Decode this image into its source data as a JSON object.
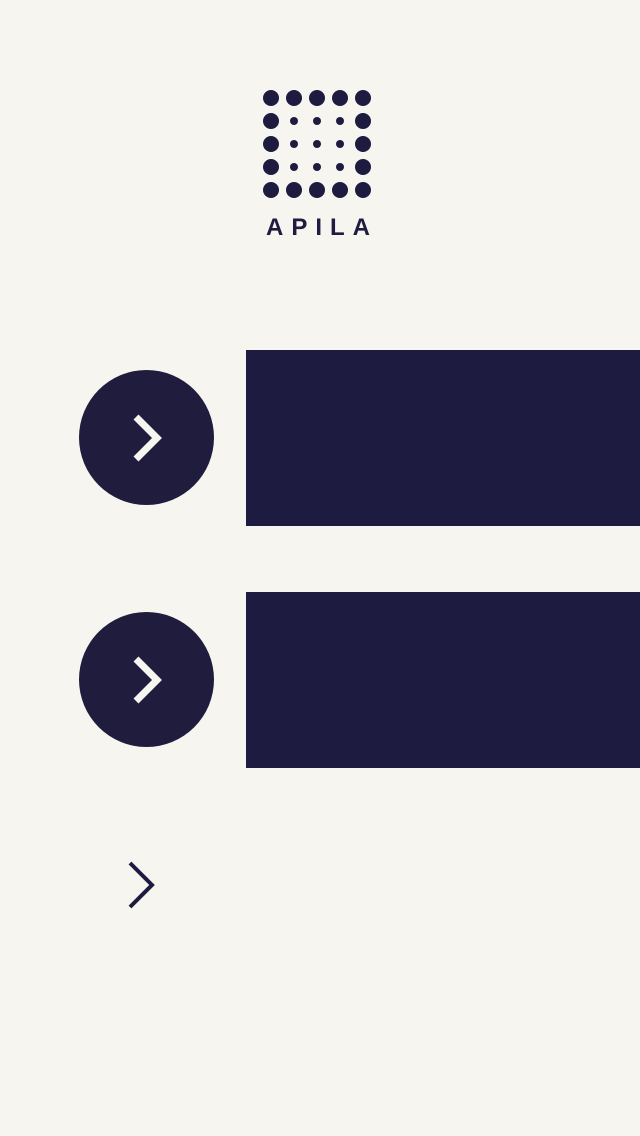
{
  "brand": {
    "name": "APILA",
    "logo_icon": "dot-grid-logo-icon",
    "primary_color": "#1e1b40",
    "background_color": "#f6f5f0",
    "accent_color": "#f6f5f0"
  },
  "nav_rows": [
    {
      "button_icon": "chevron-right-icon",
      "panel_label": ""
    },
    {
      "button_icon": "chevron-right-icon",
      "panel_label": ""
    }
  ],
  "footer_action": {
    "icon": "chevron-right-icon"
  }
}
